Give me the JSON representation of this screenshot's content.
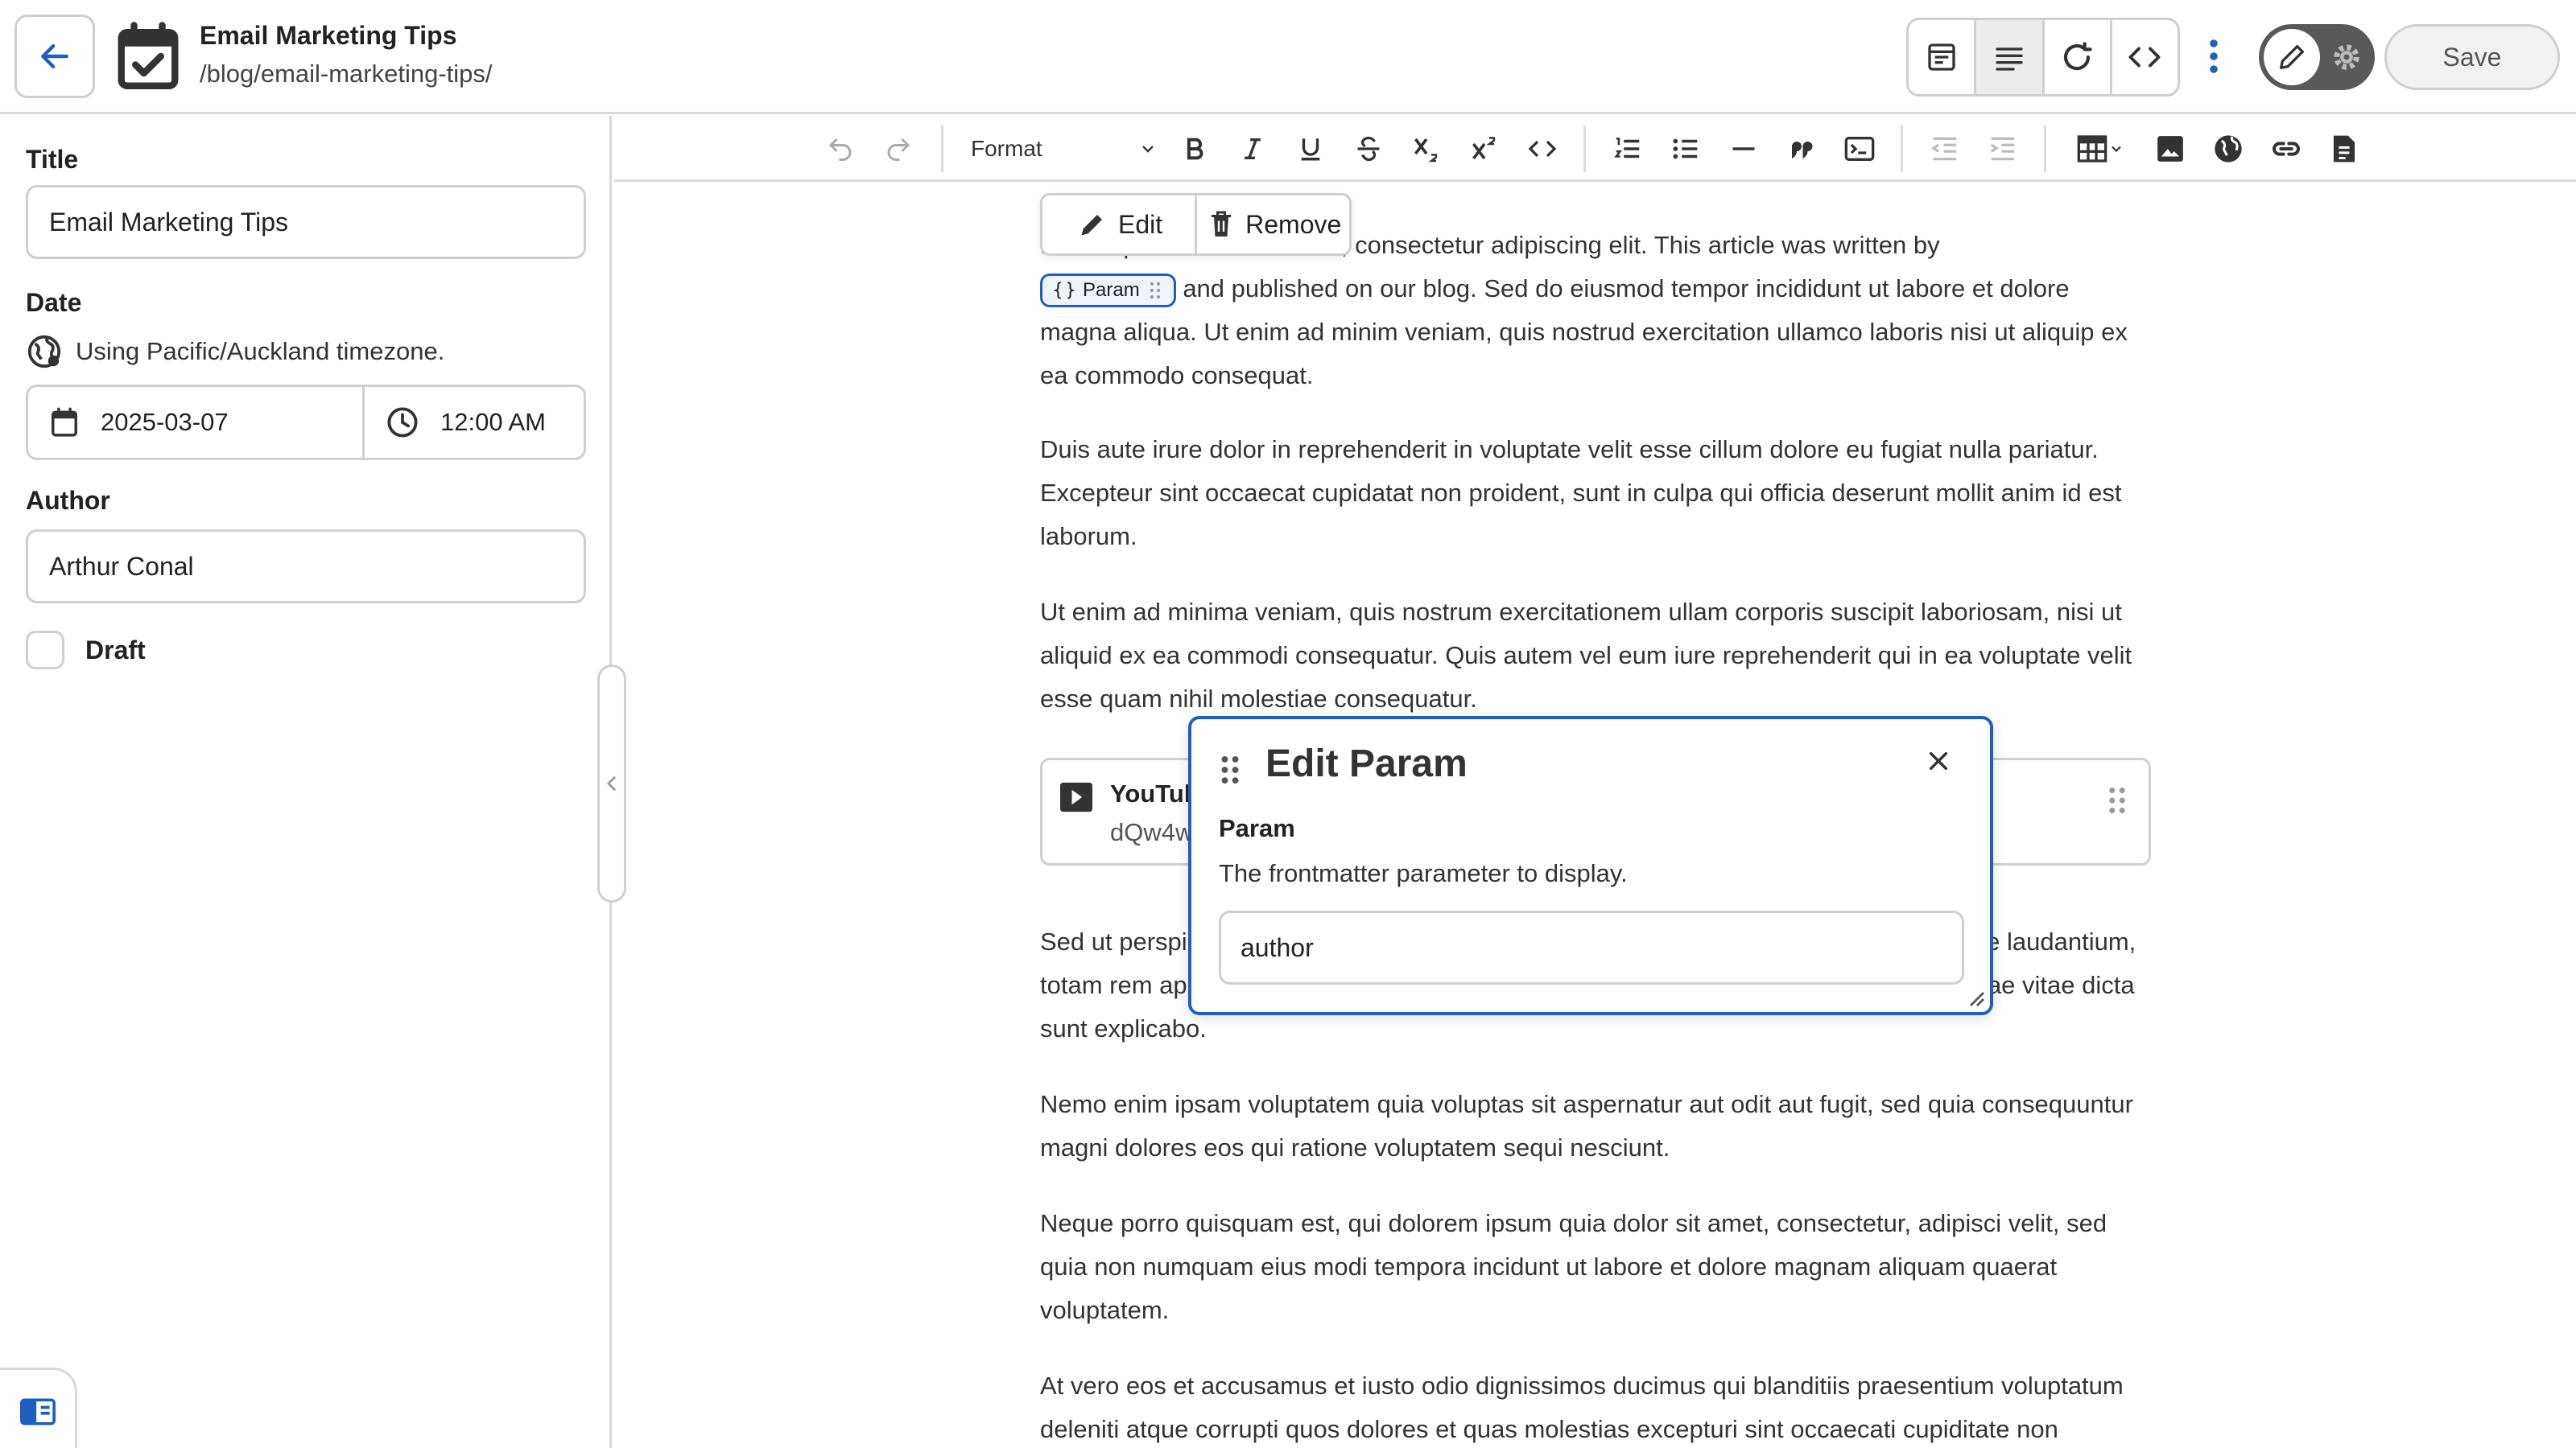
{
  "header": {
    "title": "Email Marketing Tips",
    "path": "/blog/email-marketing-tips/",
    "save_label": "Save"
  },
  "sidebar": {
    "title_label": "Title",
    "title_value": "Email Marketing Tips",
    "date_label": "Date",
    "timezone_text": "Using Pacific/Auckland timezone.",
    "date_value": "2025-03-07",
    "time_value": "12:00 AM",
    "author_label": "Author",
    "author_value": "Arthur Conal",
    "draft_label": "Draft"
  },
  "toolbar": {
    "format_label": "Format"
  },
  "editor": {
    "inline_actions": {
      "edit_label": "Edit",
      "remove_label": "Remove"
    },
    "param_chip_label": "Param",
    "para1_start": "Lorem ipsum dolor sit amet, consectetur adipiscing elit. This article was written by",
    "para1_end": "and published on our blog. Sed do eiusmod tempor incididunt ut labore et dolore magna aliqua. Ut enim ad minim veniam, quis nostrud exercitation ullamco laboris nisi ut aliquip ex ea commodo consequat.",
    "paragraphs": [
      "Duis aute irure dolor in reprehenderit in voluptate velit esse cillum dolore eu fugiat nulla pariatur. Excepteur sint occaecat cupidatat non proident, sunt in culpa qui officia deserunt mollit anim id est laborum.",
      "Ut enim ad minima veniam, quis nostrum exercitationem ullam corporis suscipit laboriosam, nisi ut aliquid ex ea commodi consequatur. Quis autem vel eum iure reprehenderit qui in ea voluptate velit esse quam nihil molestiae consequatur.",
      "Sed ut perspiciatis unde omnis iste natus error sit voluptatem accusantium doloremque laudantium, totam rem aperiam, eaque ipsa quae ab illo inventore veritatis et quasi architecto beatae vitae dicta sunt explicabo.",
      "Nemo enim ipsam voluptatem quia voluptas sit aspernatur aut odit aut fugit, sed quia consequuntur magni dolores eos qui ratione voluptatem sequi nesciunt.",
      "Neque porro quisquam est, qui dolorem ipsum quia dolor sit amet, consectetur, adipisci velit, sed quia non numquam eius modi tempora incidunt ut labore et dolore magnam aliquam quaerat voluptatem.",
      "At vero eos et accusamus et iusto odio dignissimos ducimus qui blanditiis praesentium voluptatum deleniti atque corrupti quos dolores et quas molestias excepturi sint occaecati cupiditate non provident, similique sunt in culpa qui officia deserunt mollitia animi."
    ],
    "embed": {
      "title": "YouTube",
      "subtitle": "dQw4w9WgXcQ"
    }
  },
  "dialog": {
    "title": "Edit Param",
    "field_label": "Param",
    "field_description": "The frontmatter parameter to display.",
    "field_value": "author"
  },
  "colors": {
    "accent": "#1f5fbf",
    "border": "#cfcfcf"
  }
}
